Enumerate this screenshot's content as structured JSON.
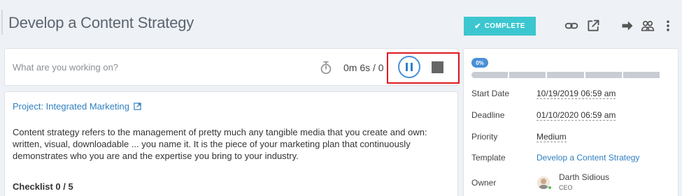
{
  "header": {
    "title": "Develop a Content Strategy",
    "complete_label": "COMPLETE",
    "icons": [
      "link-icon",
      "open-external-icon",
      "forward-arrow-icon",
      "users-icon",
      "more-vertical-icon"
    ]
  },
  "timer": {
    "placeholder": "What are you working on?",
    "value": "0m 6s / 0"
  },
  "description": {
    "project_label": "Project: Integrated Marketing",
    "text": "Content strategy refers to the management of pretty much any tangible media that you create and own: written, visual, downloadable ... you name it. It is the piece of your marketing plan that continuously demonstrates who you are and the expertise you bring to your industry.",
    "checklist_label": "Checklist 0 / 5"
  },
  "details": {
    "progress_label": "0%",
    "progress_fraction": 0,
    "fields": [
      {
        "label": "Start Date",
        "value": "10/19/2019 06:59 am"
      },
      {
        "label": "Deadline",
        "value": "01/10/2020 06:59 am"
      },
      {
        "label": "Priority",
        "value": "Medium"
      },
      {
        "label": "Template",
        "value": "Develop a Content Strategy"
      }
    ],
    "owner": {
      "label": "Owner",
      "name": "Darth Sidious",
      "role": "CEO"
    }
  },
  "colors": {
    "accent": "#3cc6cf",
    "link": "#2f7fc0",
    "progress": "#4a8fd8",
    "highlight": "#e0191f"
  }
}
